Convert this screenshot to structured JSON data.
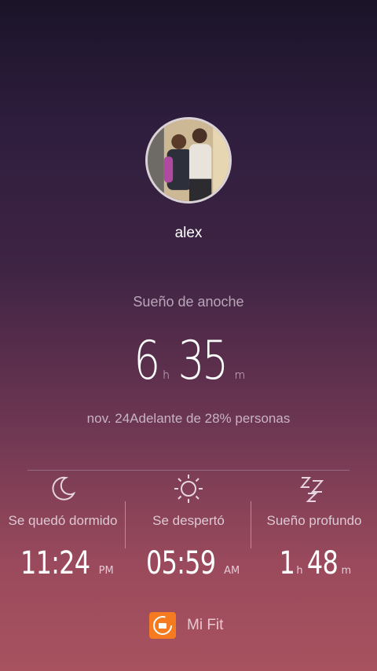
{
  "profile": {
    "name": "alex"
  },
  "sleep": {
    "title": "Sueño de anoche",
    "hours": "6",
    "hours_unit": "h",
    "minutes": "35",
    "minutes_unit": "m",
    "comparison": "nov. 24Adelante de 28% personas"
  },
  "stats": [
    {
      "icon": "moon-icon",
      "label": "Se quedó dormido",
      "value": "11:24",
      "suffix": "PM"
    },
    {
      "icon": "sun-icon",
      "label": "Se despertó",
      "value": "05:59",
      "suffix": "AM"
    },
    {
      "icon": "zzz-icon",
      "label": "Sueño profundo",
      "hours": "1",
      "hours_unit": "h",
      "minutes": "48",
      "minutes_unit": "m"
    }
  ],
  "brand": {
    "name": "Mi Fit",
    "accent": "#f57a20"
  }
}
